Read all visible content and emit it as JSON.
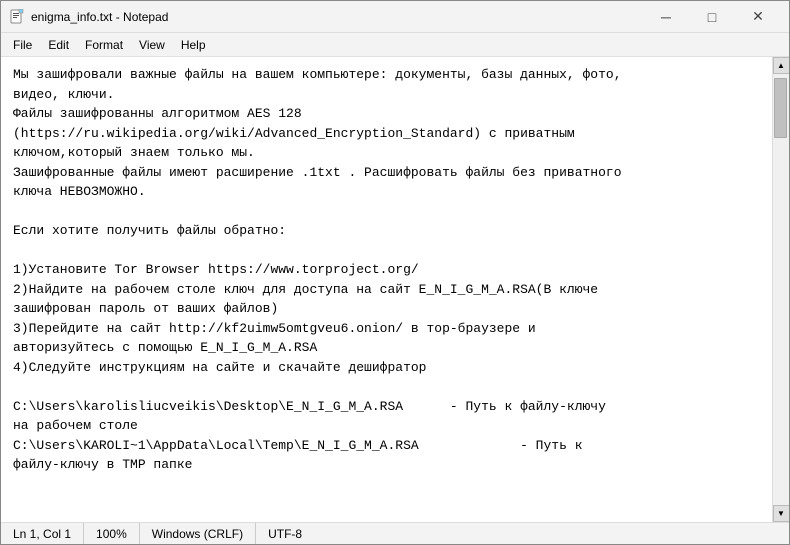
{
  "window": {
    "title": "enigma_info.txt - Notepad",
    "icon": "notepad"
  },
  "titlebar": {
    "minimize_label": "─",
    "maximize_label": "□",
    "close_label": "✕"
  },
  "menu": {
    "items": [
      {
        "label": "File"
      },
      {
        "label": "Edit"
      },
      {
        "label": "Format"
      },
      {
        "label": "View"
      },
      {
        "label": "Help"
      }
    ]
  },
  "content": {
    "text": "Мы зашифровали важные файлы на вашем компьютере: документы, базы данных, фото,\nвидео, ключи.\nФайлы зашифрованны алгоритмом AES 128\n(https://ru.wikipedia.org/wiki/Advanced_Encryption_Standard) с приватным\nключом,который знаем только мы.\nЗашифрованные файлы имеют расширение .1txt . Расшифровать файлы без приватного\nключа НЕВОЗМОЖНО.\n\nЕсли хотите получить файлы обратно:\n\n1)Установите Tor Browser https://www.torproject.org/\n2)Найдите на рабочем столе ключ для доступа на сайт E_N_I_G_M_A.RSA(В ключе\nзашифрован пароль от ваших файлов)\n3)Перейдите на сайт http://kf2uimw5omtgveu6.onion/ в тор-браузере и\nавторизуйтесь с помощью E_N_I_G_M_A.RSA\n4)Следуйте инструкциям на сайте и скачайте дешифратор\n\nC:\\Users\\karolisliucveikis\\Desktop\\E_N_I_G_M_A.RSA      - Путь к файлу-ключу\nна рабочем столе\nC:\\Users\\KAROLI~1\\AppData\\Local\\Temp\\E_N_I_G_M_A.RSA             - Путь к\nфайлу-ключу в TMP папке"
  },
  "statusbar": {
    "position": "Ln 1, Col 1",
    "zoom": "100%",
    "line_ending": "Windows (CRLF)",
    "encoding": "UTF-8"
  }
}
